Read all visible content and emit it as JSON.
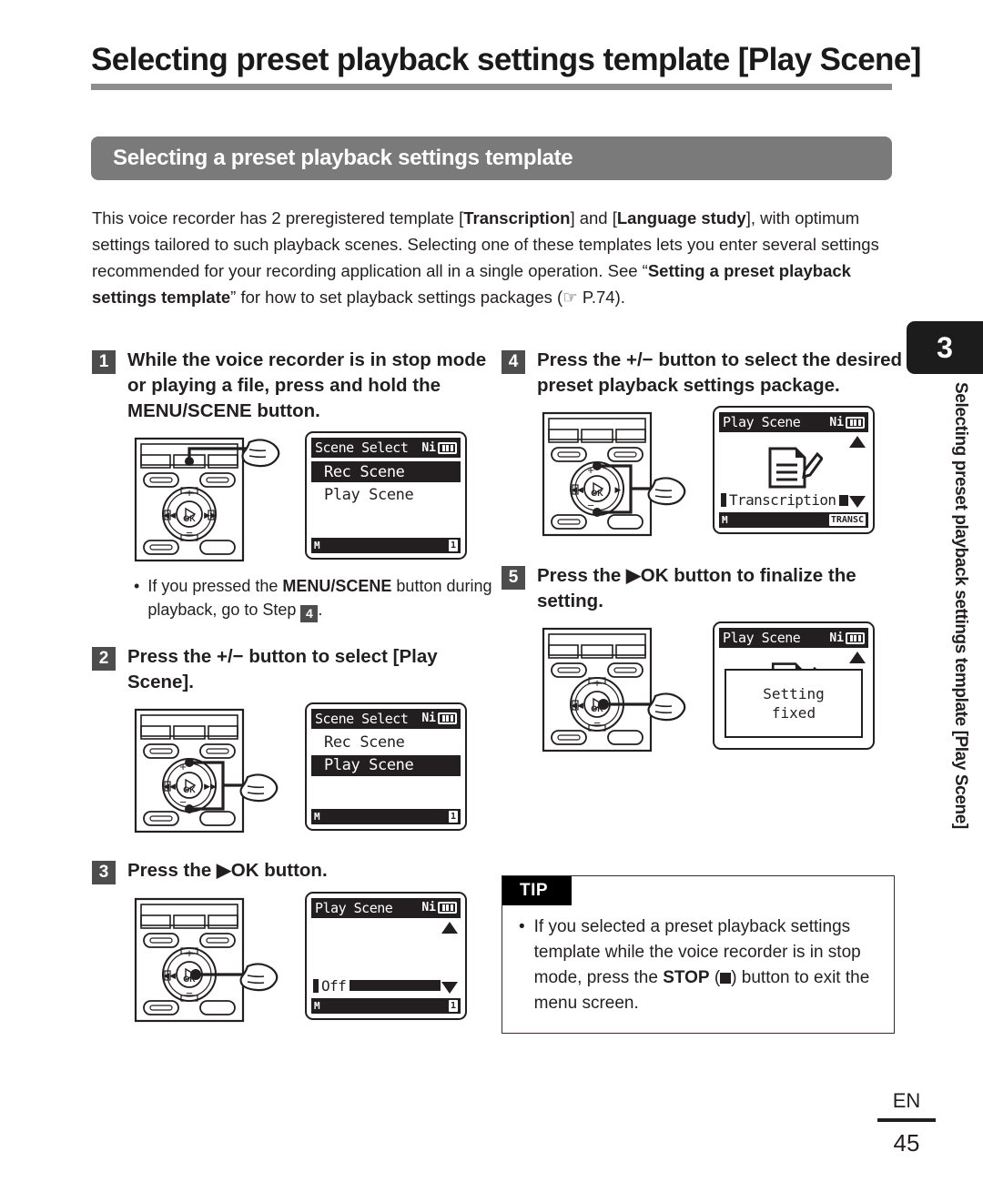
{
  "header": {
    "title": "Selecting preset playback settings template [Play Scene]",
    "subtitle": "Selecting a preset playback settings template"
  },
  "intro": {
    "line1_a": "This voice recorder has 2 preregistered template [",
    "line1_b": "Transcription",
    "line1_c": "] and [",
    "line1_d": "Language study",
    "line1_e": "], with optimum settings tailored to such playback scenes. Selecting one of these templates lets you enter several settings recommended for your recording application all in a single operation. See “",
    "line1_f": "Setting a preset playback settings template",
    "line1_g": "” for how to set playback settings packages (☞ P.74)."
  },
  "steps": [
    {
      "num": "1",
      "text": "While the voice recorder is in stop mode or playing a file, press and hold the MENU/SCENE button."
    },
    {
      "num": "2",
      "text": "Press the +/− button to select [Play Scene]."
    },
    {
      "num": "3",
      "text": "Press the ▶OK button."
    },
    {
      "num": "4",
      "text": "Press the +/− button to select the desired preset playback settings package."
    },
    {
      "num": "5",
      "text": "Press the ▶OK button to finalize the setting."
    }
  ],
  "step1_note": {
    "bullet": "•",
    "a": "If you pressed the ",
    "b": "MENU/SCENE",
    "c": " button during playback, go to Step ",
    "num": "4",
    "d": "."
  },
  "lcds": [
    {
      "title": "Scene Select",
      "ni": "Ni",
      "rows": [
        {
          "label": "Rec Scene",
          "selected": true
        },
        {
          "label": "Play Scene",
          "selected": false
        }
      ],
      "bottom_left": "M",
      "bottom_right": "1"
    },
    {
      "title": "Scene Select",
      "ni": "Ni",
      "rows": [
        {
          "label": "Rec Scene",
          "selected": false
        },
        {
          "label": "Play Scene",
          "selected": true
        }
      ],
      "bottom_left": "M",
      "bottom_right": "1"
    },
    {
      "title": "Play Scene",
      "ni": "Ni",
      "value": "Off",
      "bottom_left": "M",
      "bottom_right": "1"
    },
    {
      "title": "Play Scene",
      "ni": "Ni",
      "value": "Transcription",
      "bottom_left": "M",
      "bottom_right": "TRANSC"
    },
    {
      "title": "Play Scene",
      "ni": "Ni",
      "dialog_line1": "Setting",
      "dialog_line2": "fixed"
    }
  ],
  "recorder": {
    "ok_label": "OK",
    "plus_label": "+",
    "minus_label": "−"
  },
  "tip": {
    "label": "TIP",
    "bullet": "•",
    "a": "If you selected a preset playback settings template while the voice recorder is in stop mode, press the ",
    "b": "STOP",
    "c": " (",
    "d": ") button to exit the menu screen."
  },
  "sidebar": {
    "chapter": "3",
    "vertical_text": "Selecting preset playback settings template [Play Scene]"
  },
  "footer": {
    "lang": "EN",
    "page": "45"
  }
}
